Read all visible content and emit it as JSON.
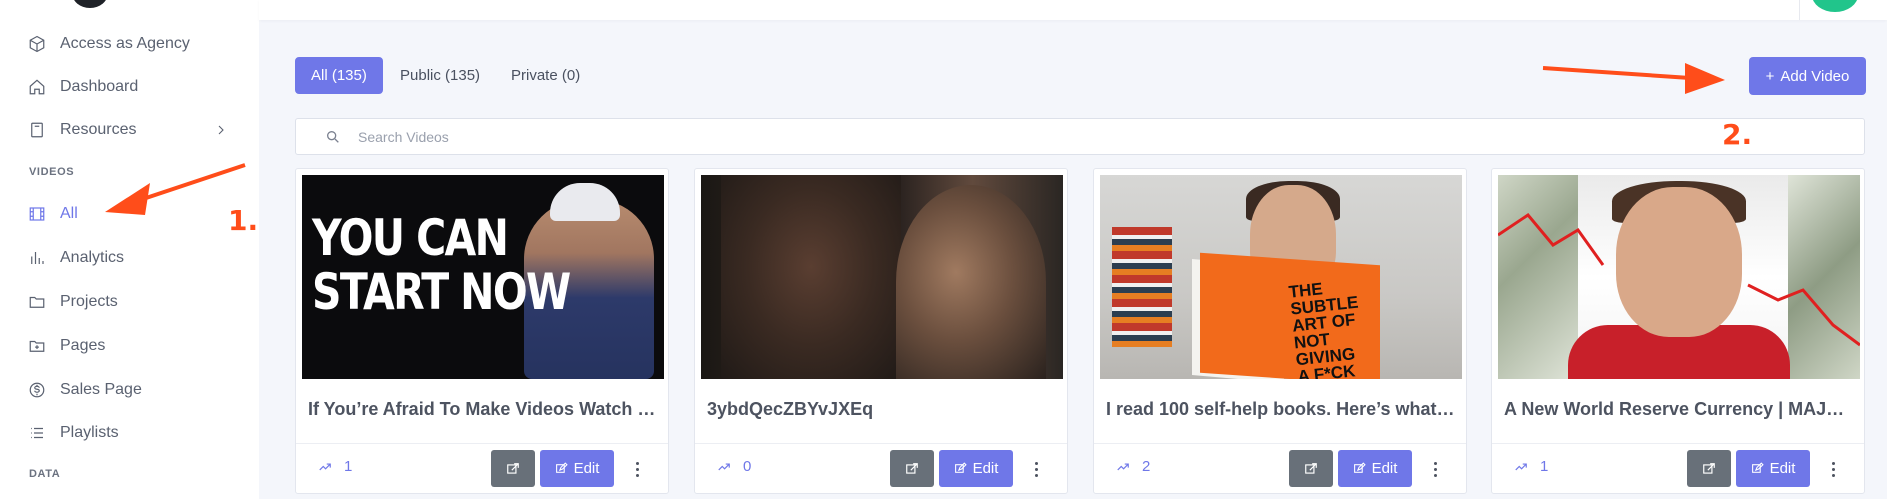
{
  "sidebar": {
    "items_top": [
      {
        "label": "Access as Agency",
        "icon": "cube-icon"
      },
      {
        "label": "Dashboard",
        "icon": "home-icon"
      },
      {
        "label": "Resources",
        "icon": "book-icon"
      }
    ],
    "section_videos": "VIDEOS",
    "items_videos": [
      {
        "label": "All",
        "icon": "film-icon",
        "active": true
      },
      {
        "label": "Analytics",
        "icon": "bar-chart-icon"
      },
      {
        "label": "Projects",
        "icon": "folder-icon"
      },
      {
        "label": "Pages",
        "icon": "file-plus-icon"
      },
      {
        "label": "Sales Page",
        "icon": "dollar-circle-icon"
      },
      {
        "label": "Playlists",
        "icon": "list-icon"
      }
    ],
    "section_data": "DATA"
  },
  "tabs": [
    {
      "label": "All (135)",
      "active": true
    },
    {
      "label": "Public (135)"
    },
    {
      "label": "Private (0)"
    }
  ],
  "add_video": {
    "label": "Add Video",
    "icon": "plus-icon"
  },
  "search": {
    "placeholder": "Search Videos"
  },
  "videos": [
    {
      "title": "If You’re Afraid To Make Videos Watch T...",
      "stat": "1",
      "edit": "Edit",
      "thumb_text": "YOU CAN\nSTART NOW"
    },
    {
      "title": "3ybdQecZBYvJXEq",
      "stat": "0",
      "edit": "Edit"
    },
    {
      "title": "I read 100 self-help books. Here’s what I...",
      "stat": "2",
      "edit": "Edit",
      "thumb_text": "THE\nSUBTLE\nART OF\nNOT\nGIVING\nA F*CK"
    },
    {
      "title": "A New World Reserve Currency | MAJO...",
      "stat": "1",
      "edit": "Edit"
    }
  ],
  "annotations": {
    "step1": "1.",
    "step2": "2."
  },
  "colors": {
    "accent": "#6f77e8",
    "annotation": "#ff4d1a",
    "dark_button": "#687079"
  }
}
